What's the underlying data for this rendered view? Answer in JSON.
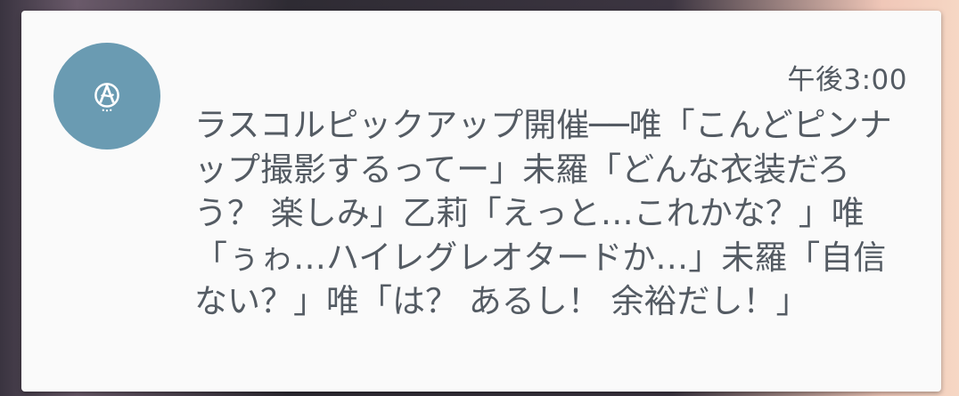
{
  "notification": {
    "time": "午後3:00",
    "app_icon": "app-logo-icon",
    "icon_color": "#6a9bb2",
    "message": "ラスコルピックアップ開催──唯「こんどピンナップ撮影するってー」未羅「どんな衣装だろう？ 楽しみ」乙莉「えっと…これかな？」唯「ぅゎ…ハイレグレオタードか…」未羅「自信ない？」唯「は？ あるし！ 余裕だし！」"
  }
}
